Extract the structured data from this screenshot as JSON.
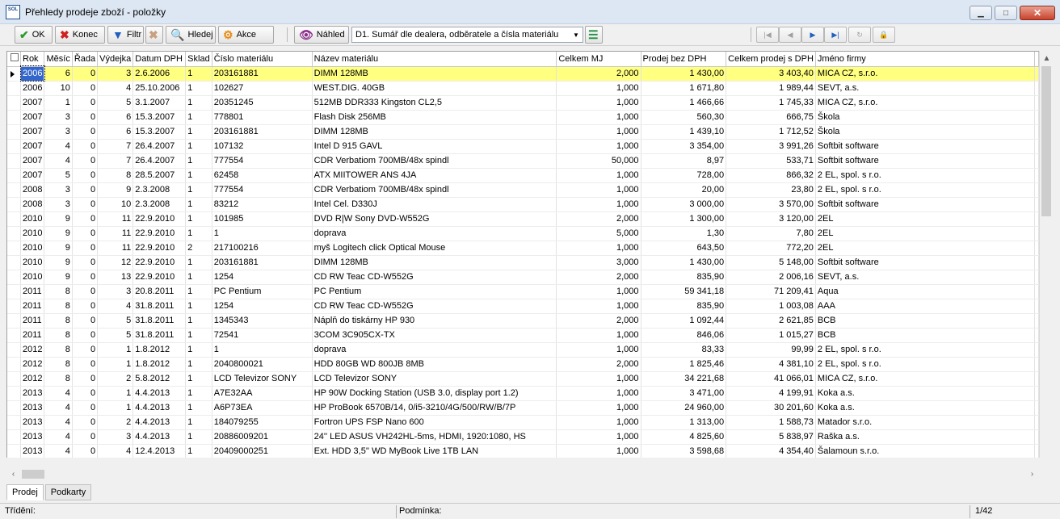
{
  "window": {
    "logo_text": "SOL",
    "title": "Přehledy prodeje zboží - položky"
  },
  "toolbar": {
    "ok": "OK",
    "konec": "Konec",
    "filtr": "Filtr",
    "hledej": "Hledej",
    "akce": "Akce",
    "nahled": "Náhled",
    "report": "D1. Sumář dle dealera, odběratele a čísla materiálu"
  },
  "columns": [
    "Rok",
    "Měsíc",
    "Řada",
    "Výdejka",
    "Datum DPH",
    "Sklad",
    "Číslo materiálu",
    "Název materiálu",
    "Celkem MJ",
    "Prodej bez DPH",
    "Celkem prodej s DPH",
    "Jméno firmy"
  ],
  "rows": [
    [
      "2006",
      "6",
      "0",
      "3",
      "2.6.2006",
      "1",
      "203161881",
      "DIMM 128MB",
      "2,000",
      "1 430,00",
      "3 403,40",
      "MICA CZ, s.r.o."
    ],
    [
      "2006",
      "10",
      "0",
      "4",
      "25.10.2006",
      "1",
      "102627",
      "WEST.DIG. 40GB",
      "1,000",
      "1 671,80",
      "1 989,44",
      "SEVT, a.s."
    ],
    [
      "2007",
      "1",
      "0",
      "5",
      "3.1.2007",
      "1",
      "20351245",
      "512MB DDR333 Kingston CL2,5",
      "1,000",
      "1 466,66",
      "1 745,33",
      "MICA CZ, s.r.o."
    ],
    [
      "2007",
      "3",
      "0",
      "6",
      "15.3.2007",
      "1",
      "778801",
      "Flash Disk 256MB",
      "1,000",
      "560,30",
      "666,75",
      "Škola"
    ],
    [
      "2007",
      "3",
      "0",
      "6",
      "15.3.2007",
      "1",
      "203161881",
      "DIMM 128MB",
      "1,000",
      "1 439,10",
      "1 712,52",
      "Škola"
    ],
    [
      "2007",
      "4",
      "0",
      "7",
      "26.4.2007",
      "1",
      "107132",
      "Intel D 915 GAVL",
      "1,000",
      "3 354,00",
      "3 991,26",
      "Softbit software"
    ],
    [
      "2007",
      "4",
      "0",
      "7",
      "26.4.2007",
      "1",
      "777554",
      "CDR Verbatiom 700MB/48x spindl",
      "50,000",
      "8,97",
      "533,71",
      "Softbit software"
    ],
    [
      "2007",
      "5",
      "0",
      "8",
      "28.5.2007",
      "1",
      "62458",
      "ATX MIITOWER ANS 4JA",
      "1,000",
      "728,00",
      "866,32",
      "2 EL, spol. s r.o."
    ],
    [
      "2008",
      "3",
      "0",
      "9",
      "2.3.2008",
      "1",
      "777554",
      "CDR Verbatiom 700MB/48x spindl",
      "1,000",
      "20,00",
      "23,80",
      "2 EL, spol. s r.o."
    ],
    [
      "2008",
      "3",
      "0",
      "10",
      "2.3.2008",
      "1",
      "83212",
      "Intel Cel. D330J",
      "1,000",
      "3 000,00",
      "3 570,00",
      "Softbit software"
    ],
    [
      "2010",
      "9",
      "0",
      "11",
      "22.9.2010",
      "1",
      "101985",
      "DVD R|W Sony DVD-W552G",
      "2,000",
      "1 300,00",
      "3 120,00",
      "2EL"
    ],
    [
      "2010",
      "9",
      "0",
      "11",
      "22.9.2010",
      "1",
      "1",
      "doprava",
      "5,000",
      "1,30",
      "7,80",
      "2EL"
    ],
    [
      "2010",
      "9",
      "0",
      "11",
      "22.9.2010",
      "2",
      "217100216",
      "myš Logitech click Optical Mouse",
      "1,000",
      "643,50",
      "772,20",
      "2EL"
    ],
    [
      "2010",
      "9",
      "0",
      "12",
      "22.9.2010",
      "1",
      "203161881",
      "DIMM 128MB",
      "3,000",
      "1 430,00",
      "5 148,00",
      "Softbit software"
    ],
    [
      "2010",
      "9",
      "0",
      "13",
      "22.9.2010",
      "1",
      "1254",
      "CD RW Teac CD-W552G",
      "2,000",
      "835,90",
      "2 006,16",
      "SEVT, a.s."
    ],
    [
      "2011",
      "8",
      "0",
      "3",
      "20.8.2011",
      "1",
      "PC Pentium",
      "PC Pentium",
      "1,000",
      "59 341,18",
      "71 209,41",
      "Aqua"
    ],
    [
      "2011",
      "8",
      "0",
      "4",
      "31.8.2011",
      "1",
      "1254",
      "CD RW Teac CD-W552G",
      "1,000",
      "835,90",
      "1 003,08",
      "AAA"
    ],
    [
      "2011",
      "8",
      "0",
      "5",
      "31.8.2011",
      "1",
      "1345343",
      "Náplň do tiskárny HP 930",
      "2,000",
      "1 092,44",
      "2 621,85",
      "BCB"
    ],
    [
      "2011",
      "8",
      "0",
      "5",
      "31.8.2011",
      "1",
      "72541",
      "3COM 3C905CX-TX",
      "1,000",
      "846,06",
      "1 015,27",
      "BCB"
    ],
    [
      "2012",
      "8",
      "0",
      "1",
      "1.8.2012",
      "1",
      "1",
      "doprava",
      "1,000",
      "83,33",
      "99,99",
      "2 EL, spol. s r.o."
    ],
    [
      "2012",
      "8",
      "0",
      "1",
      "1.8.2012",
      "1",
      "2040800021",
      "HDD 80GB WD 800JB 8MB",
      "2,000",
      "1 825,46",
      "4 381,10",
      "2 EL, spol. s r.o."
    ],
    [
      "2012",
      "8",
      "0",
      "2",
      "5.8.2012",
      "1",
      "LCD Televizor SONY",
      "LCD Televizor SONY",
      "1,000",
      "34 221,68",
      "41 066,01",
      "MICA CZ, s.r.o."
    ],
    [
      "2013",
      "4",
      "0",
      "1",
      "4.4.2013",
      "1",
      "A7E32AA",
      "HP 90W Docking Station (USB 3.0, display port 1.2)",
      "1,000",
      "3 471,00",
      "4 199,91",
      "Koka a.s."
    ],
    [
      "2013",
      "4",
      "0",
      "1",
      "4.4.2013",
      "1",
      "A6P73EA",
      "HP ProBook 6570B/14, 0/i5-3210/4G/500/RW/B/7P",
      "1,000",
      "24 960,00",
      "30 201,60",
      "Koka a.s."
    ],
    [
      "2013",
      "4",
      "0",
      "2",
      "4.4.2013",
      "1",
      "184079255",
      "Fortron UPS FSP Nano 600",
      "1,000",
      "1 313,00",
      "1 588,73",
      "Matador s.r.o."
    ],
    [
      "2013",
      "4",
      "0",
      "3",
      "4.4.2013",
      "1",
      "20886009201",
      "24'' LED ASUS VH242HL-5ms, HDMI, 1920:1080, HS",
      "1,000",
      "4 825,60",
      "5 838,97",
      "Raška a.s."
    ],
    [
      "2013",
      "4",
      "0",
      "4",
      "12.4.2013",
      "1",
      "20409000251",
      "Ext. HDD 3,5'' WD MyBook Live 1TB LAN",
      "1,000",
      "3 598,68",
      "4 354,40",
      "Šalamoun s.r.o."
    ]
  ],
  "tabs": [
    "Prodej",
    "Podkarty"
  ],
  "status": {
    "trideni": "Třídění:",
    "podminka": "Podmínka:",
    "counter": "1/42"
  }
}
